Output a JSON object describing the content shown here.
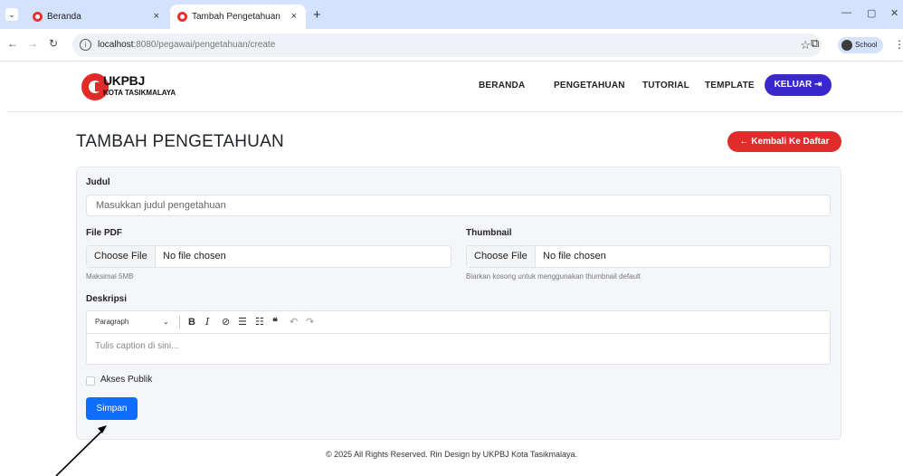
{
  "browser": {
    "tabs": [
      {
        "title": "Beranda",
        "active": false
      },
      {
        "title": "Tambah Pengetahuan",
        "active": true
      }
    ],
    "tab_close_glyph": "×",
    "new_tab_glyph": "+",
    "url_host": "localhost",
    "url_path": ":8080/pegawai/pengetahuan/create",
    "profile_label": "School"
  },
  "site": {
    "logo_title": "UKPBJ",
    "logo_subtitle": "KOTA TASIKMALAYA",
    "nav": [
      "BERANDA",
      "PENGETAHUAN",
      "TUTORIAL",
      "TEMPLATE"
    ],
    "logout_label": "KELUAR ⇥"
  },
  "page": {
    "title": "TAMBAH PENGETAHUAN",
    "back_label": "← Kembali Ke Daftar"
  },
  "form": {
    "judul_label": "Judul",
    "judul_placeholder": "Masukkan judul pengetahuan",
    "pdf_label": "File PDF",
    "pdf_button": "Choose File",
    "pdf_status": "No file chosen",
    "pdf_hint": "Maksimal 5MB",
    "thumb_label": "Thumbnail",
    "thumb_button": "Choose File",
    "thumb_status": "No file chosen",
    "thumb_hint": "Biarkan kosong untuk menggunakan thumbnail default",
    "desc_label": "Deskripsi",
    "editor_paragraph": "Paragraph",
    "editor_placeholder": "Tulis caption di sini...",
    "public_label": "Akses Publik",
    "public_checked": false,
    "save_label": "Simpan"
  },
  "footer": "© 2025 All Rights Reserved. Rin Design by UKPBJ Kota Tasikmalaya.",
  "colors": {
    "brand_red": "#e02b27",
    "logout_purple": "#3b28cc",
    "primary_blue": "#0d6efd"
  },
  "icons": [
    "tab-search-icon",
    "favicon-icon",
    "back-arrow-icon",
    "forward-arrow-icon",
    "reload-icon",
    "site-info-icon",
    "bookmark-star-icon",
    "extensions-icon",
    "kebab-menu-icon",
    "bold-icon",
    "italic-icon",
    "link-icon",
    "bulleted-list-icon",
    "numbered-list-icon",
    "blockquote-icon",
    "undo-icon",
    "redo-icon",
    "annotation-arrow"
  ]
}
